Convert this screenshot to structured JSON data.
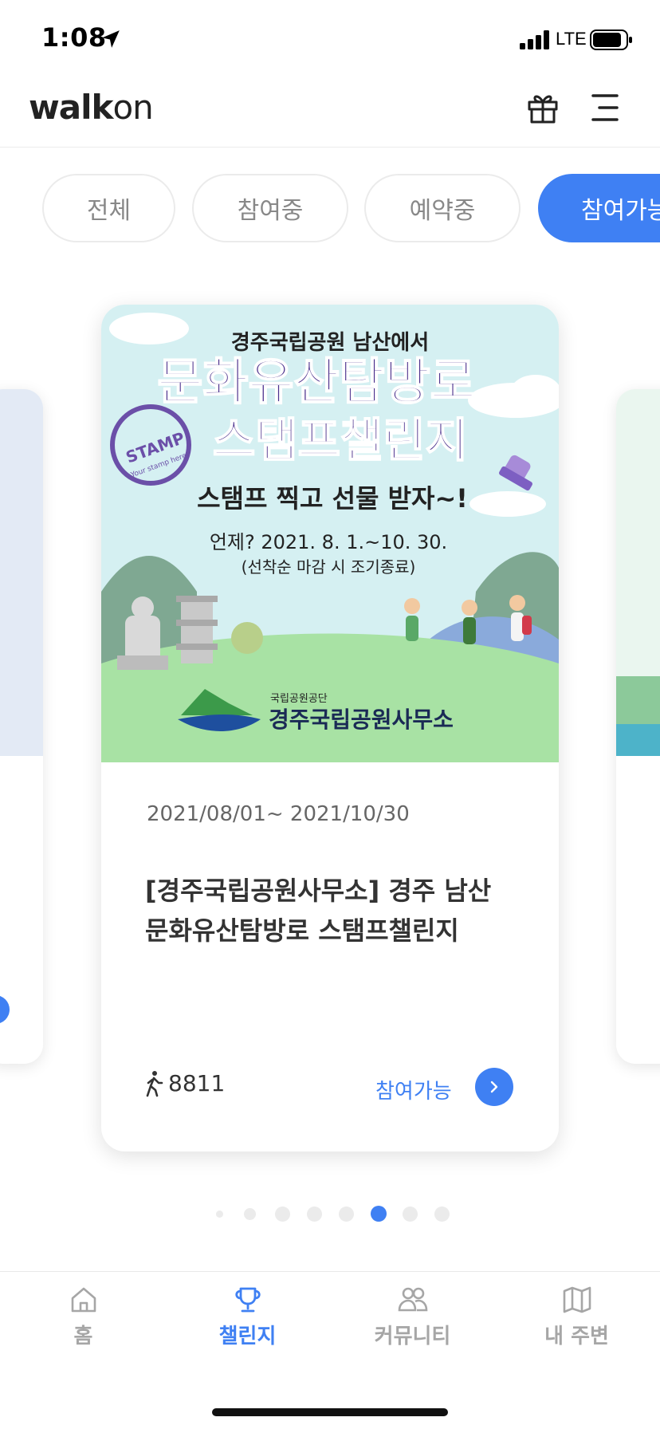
{
  "status_bar": {
    "time": "1:08",
    "network": "LTE"
  },
  "header": {
    "logo_bold": "walk",
    "logo_thin": "on"
  },
  "chips": [
    {
      "label": "전체",
      "active": false
    },
    {
      "label": "참여중",
      "active": false
    },
    {
      "label": "예약중",
      "active": false
    },
    {
      "label": "참여가능",
      "active": true
    }
  ],
  "challenge": {
    "banner": {
      "line1": "경주국립공원 남산에서",
      "line2": "문화유산탐방로",
      "line3": "스탬프챌린지",
      "stamp": "STAMP",
      "stamp_sub": "Your stamp here",
      "line4": "스탬프 찍고 선물 받자~!",
      "line5": "언제? 2021. 8. 1.~10. 30.",
      "line6": "(선착순 마감 시 조기종료)",
      "org_small": "국립공원공단",
      "org_big": "경주국립공원사무소"
    },
    "period": "2021/08/01~ 2021/10/30",
    "title": "[경주국립공원사무소] 경주 남산 문화유산탐방로 스탬프챌린지",
    "participants": "8811",
    "status": "참여가능"
  },
  "pagination": {
    "total": 8,
    "active_index": 5
  },
  "bottom_nav": [
    {
      "label": "홈",
      "icon": "home-icon",
      "active": false
    },
    {
      "label": "챌린지",
      "icon": "trophy-icon",
      "active": true
    },
    {
      "label": "커뮤니티",
      "icon": "community-icon",
      "active": false
    },
    {
      "label": "내 주변",
      "icon": "map-icon",
      "active": false
    }
  ],
  "colors": {
    "accent": "#3f80f3",
    "inactive": "#a6a6a6",
    "chip_border": "#ebebeb",
    "banner_title": "#4a2f8c"
  }
}
